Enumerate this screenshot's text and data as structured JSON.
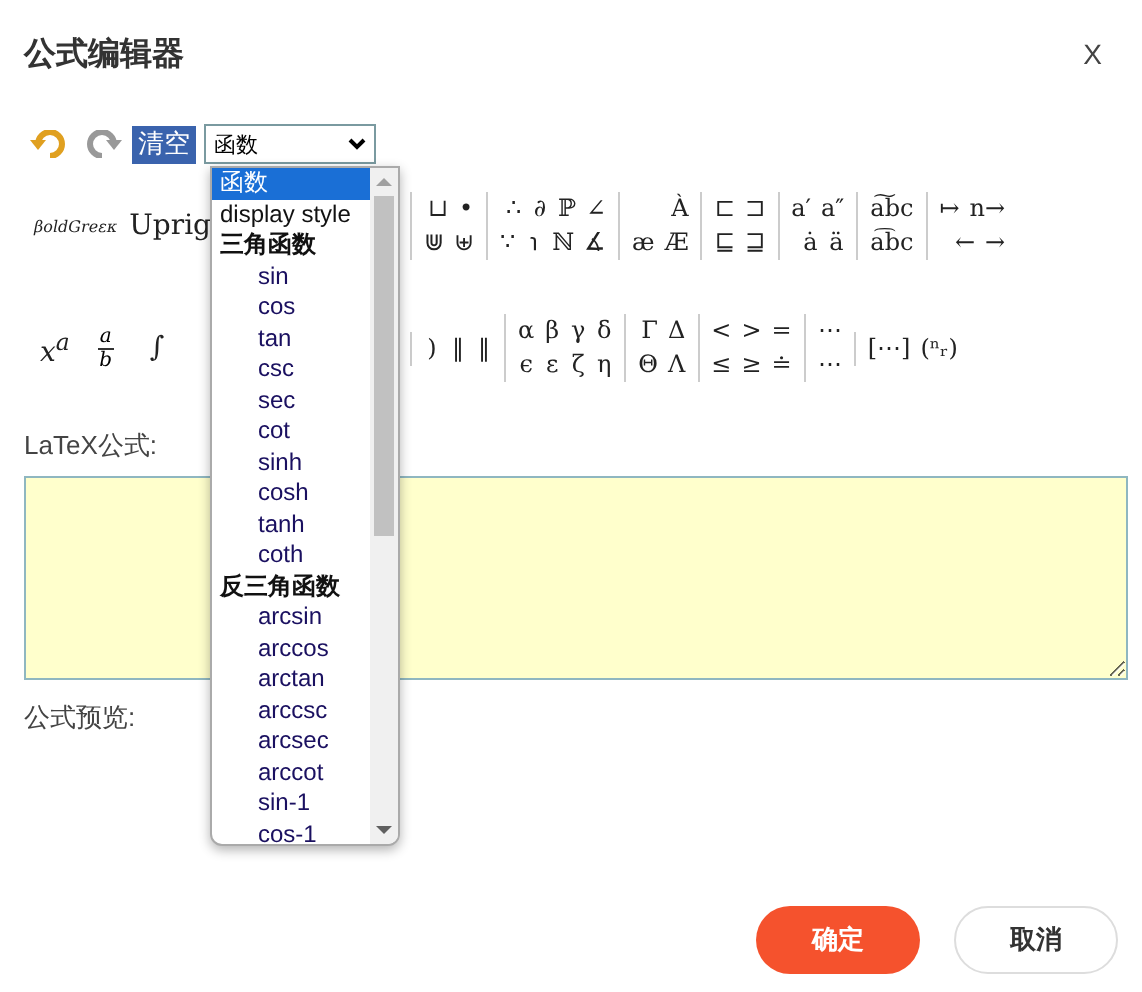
{
  "dialog": {
    "title": "公式编辑器",
    "close": "X"
  },
  "toolbar": {
    "clear": "清空",
    "select_value": "函数"
  },
  "palette_rows": [
    {
      "lead": [
        {
          "kind": "small",
          "text": "βoldGreεκ"
        },
        {
          "kind": "text",
          "text": "Uprig"
        }
      ],
      "groups": [
        {
          "top": [
            "⊔",
            "•"
          ],
          "bottom": [
            "⋓",
            "⊎"
          ]
        },
        {
          "top": [
            "∴",
            "∂",
            "ℙ",
            "∠"
          ],
          "bottom": [
            "∵",
            "℩",
            "ℕ",
            "∡"
          ]
        },
        {
          "top": [
            "À"
          ],
          "bottom": [
            "æ",
            "Æ"
          ]
        },
        {
          "top": [
            "⊏",
            "⊐"
          ],
          "bottom": [
            "⊑",
            "⊒"
          ]
        },
        {
          "top": [
            "a′",
            "a″"
          ],
          "bottom": [
            "ȧ",
            "ä"
          ]
        },
        {
          "top": [
            "a͠bc"
          ],
          "bottom": [
            "a͡bc"
          ]
        },
        {
          "top": [
            "↦",
            "n→"
          ],
          "bottom": [
            "←",
            "→"
          ]
        }
      ]
    },
    {
      "lead": [
        {
          "kind": "sup",
          "text": "x$^{a}$"
        },
        {
          "kind": "frac",
          "num": "a",
          "den": "b"
        },
        {
          "kind": "text",
          "text": "∫"
        }
      ],
      "groups": [
        {
          "top": [
            ")",
            "‖",
            "‖"
          ]
        },
        {
          "top": [
            "α",
            "β",
            "γ",
            "δ"
          ],
          "bottom": [
            "ϵ",
            "ε",
            "ζ",
            "η"
          ]
        },
        {
          "top": [
            "Γ",
            "Δ"
          ],
          "bottom": [
            "Θ",
            "Λ"
          ]
        },
        {
          "top": [
            "<",
            ">",
            "="
          ],
          "bottom": [
            "≤",
            "≥",
            "≐"
          ]
        },
        {
          "top": [
            "⋯"
          ],
          "bottom": [
            "⋯"
          ]
        },
        {
          "top": [
            "[⋯]",
            "(ⁿᵣ)"
          ]
        }
      ]
    }
  ],
  "latex_label": "LaTeX公式:",
  "preview_label": "公式预览:",
  "buttons": [
    {
      "kind": "primary",
      "label": "确定"
    },
    {
      "kind": "secondary",
      "label": "取消"
    }
  ],
  "dropdown": {
    "options": [
      {
        "kind": "top",
        "label": "函数",
        "selected": true
      },
      {
        "kind": "top",
        "label": "display style",
        "selected": false
      },
      {
        "kind": "group",
        "label": "三角函数",
        "selected": false
      },
      {
        "kind": "item",
        "label": "sin",
        "selected": false
      },
      {
        "kind": "item",
        "label": "cos",
        "selected": false
      },
      {
        "kind": "item",
        "label": "tan",
        "selected": false
      },
      {
        "kind": "item",
        "label": "csc",
        "selected": false
      },
      {
        "kind": "item",
        "label": "sec",
        "selected": false
      },
      {
        "kind": "item",
        "label": "cot",
        "selected": false
      },
      {
        "kind": "item",
        "label": "sinh",
        "selected": false
      },
      {
        "kind": "item",
        "label": "cosh",
        "selected": false
      },
      {
        "kind": "item",
        "label": "tanh",
        "selected": false
      },
      {
        "kind": "item",
        "label": "coth",
        "selected": false
      },
      {
        "kind": "group",
        "label": "反三角函数",
        "selected": false
      },
      {
        "kind": "item",
        "label": "arcsin",
        "selected": false
      },
      {
        "kind": "item",
        "label": "arccos",
        "selected": false
      },
      {
        "kind": "item",
        "label": "arctan",
        "selected": false
      },
      {
        "kind": "item",
        "label": "arccsc",
        "selected": false
      },
      {
        "kind": "item",
        "label": "arcsec",
        "selected": false
      },
      {
        "kind": "item",
        "label": "arccot",
        "selected": false
      },
      {
        "kind": "item",
        "label": "sin-1",
        "selected": false
      },
      {
        "kind": "item",
        "label": "cos-1",
        "selected": false
      }
    ]
  }
}
